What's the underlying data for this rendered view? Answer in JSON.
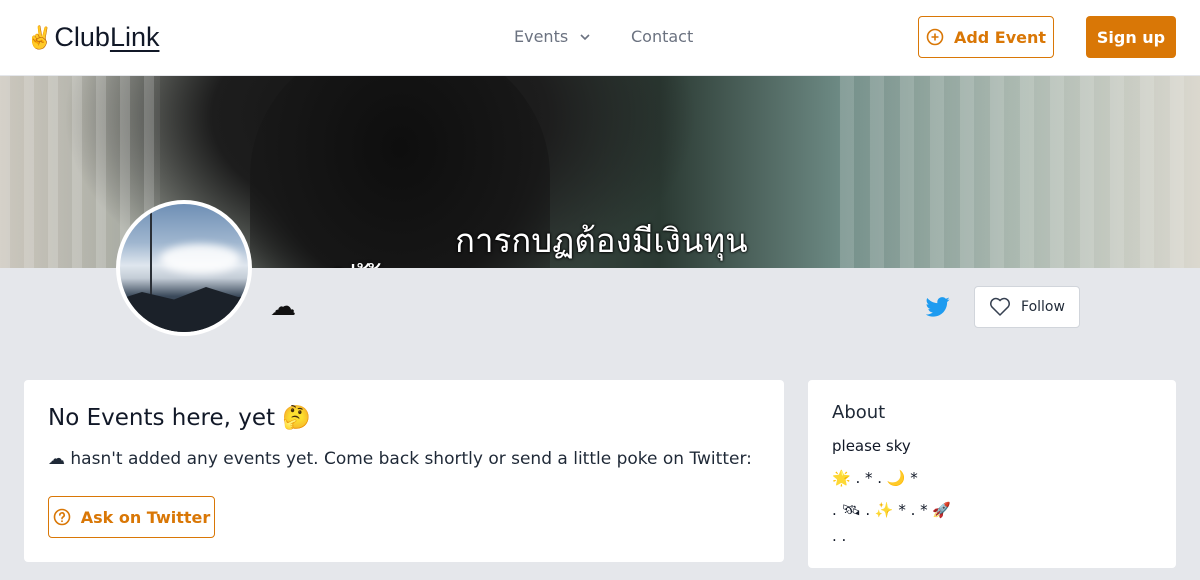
{
  "header": {
    "logo_emoji": "✌️",
    "logo_text_a": "Club",
    "logo_text_b": "Link",
    "nav_events_label": "Events",
    "nav_contact_label": "Contact",
    "add_event_label": "Add Event",
    "signup_label": "Sign up"
  },
  "banner": {
    "caption_line1": "การกบฏต้องมีเงินทุน",
    "caption_line2": "ใ                      ่                ้  ้"
  },
  "profile": {
    "name_emoji": "☁",
    "follow_label": "Follow"
  },
  "events_card": {
    "title": "No Events here, yet 🤔",
    "message": "☁ hasn't added any events yet. Come back shortly or send a little poke on Twitter:",
    "ask_label": "Ask on Twitter"
  },
  "about_card": {
    "title": "About",
    "lines": [
      "please sky",
      "🌟 . * . 🌙 *",
      ". 🛰 . ✨ * . * 🚀",
      ". ."
    ]
  },
  "colors": {
    "accent": "#d97706",
    "twitter": "#1d9bf0",
    "page_bg": "#e5e7eb"
  }
}
